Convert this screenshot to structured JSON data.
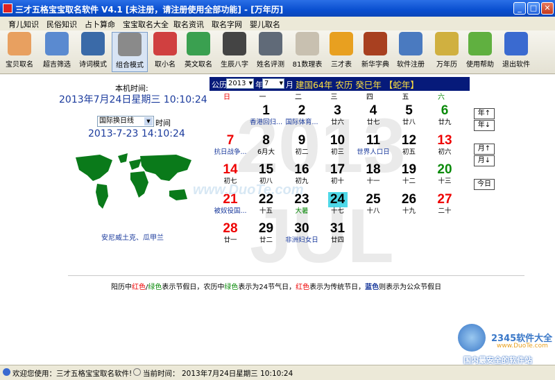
{
  "window": {
    "title": "三才五格宝宝取名软件 V4.1 [未注册，请注册使用全部功能] - [万年历]"
  },
  "menu": [
    "育儿知识",
    "民俗知识",
    "占卜算命",
    "宝宝取名大全",
    "取名资讯",
    "取名字网",
    "婴儿取名"
  ],
  "toolbar": [
    {
      "label": "宝贝取名",
      "icon": "baby-icon",
      "color": "#e8a060"
    },
    {
      "label": "超吉筛选",
      "icon": "magnifier-icon",
      "color": "#5a8ad0"
    },
    {
      "label": "诗词模式",
      "icon": "book-icon",
      "color": "#3a6aa8"
    },
    {
      "label": "组合模式",
      "icon": "gear-icon",
      "color": "#8a8a8a"
    },
    {
      "label": "取小名",
      "icon": "child-icon",
      "color": "#d04040"
    },
    {
      "label": "英文取名",
      "icon": "globe-icon",
      "color": "#3aa050"
    },
    {
      "label": "生辰八字",
      "icon": "yinyang-icon",
      "color": "#444444"
    },
    {
      "label": "姓名评测",
      "icon": "calculator-icon",
      "color": "#606a78"
    },
    {
      "label": "81数理表",
      "icon": "table-icon",
      "color": "#c8c0b0"
    },
    {
      "label": "三才表",
      "icon": "shell-icon",
      "color": "#e8a020"
    },
    {
      "label": "新华字典",
      "icon": "dictionary-icon",
      "color": "#a84020"
    },
    {
      "label": "软件注册",
      "icon": "tools-icon",
      "color": "#4a7ac0"
    },
    {
      "label": "万年历",
      "icon": "calendar-icon",
      "color": "#d0b040"
    },
    {
      "label": "使用帮助",
      "icon": "help-icon",
      "color": "#60b040"
    },
    {
      "label": "退出软件",
      "icon": "exit-icon",
      "color": "#3a6ad0"
    }
  ],
  "clock": {
    "local_label": "本机时间:",
    "local_time": "2013年7月24日星期三  10:10:24",
    "zone_select": "国际换日线",
    "zone_suffix": "时间",
    "zone_time": "2013-7-23 14:10:24",
    "location": "安尼威土克、瓜甲兰"
  },
  "calendar": {
    "gongli_label": "公历",
    "year": "2013",
    "year_unit": "年",
    "month": "7",
    "month_unit": "月",
    "lunar_info": "建国64年  农历 癸巳年 【蛇年】",
    "weekdays": [
      "日",
      "一",
      "二",
      "三",
      "四",
      "五",
      "六"
    ],
    "watermark_year": "2013",
    "watermark_month": "JUL",
    "selected_day": "24",
    "days": [
      {
        "n": "1",
        "l": "香港回归...",
        "col": 1,
        "row": 0,
        "nc": "#000",
        "lc": "#1a3a9c"
      },
      {
        "n": "2",
        "l": "国际体育...",
        "col": 2,
        "row": 0,
        "nc": "#000",
        "lc": "#1a3a9c"
      },
      {
        "n": "3",
        "l": "廿六",
        "col": 3,
        "row": 0,
        "nc": "#000",
        "lc": "#000"
      },
      {
        "n": "4",
        "l": "廿七",
        "col": 4,
        "row": 0,
        "nc": "#000",
        "lc": "#000"
      },
      {
        "n": "5",
        "l": "廿八",
        "col": 5,
        "row": 0,
        "nc": "#000",
        "lc": "#000"
      },
      {
        "n": "6",
        "l": "廿九",
        "col": 6,
        "row": 0,
        "nc": "#0a8a0a",
        "lc": "#000"
      },
      {
        "n": "7",
        "l": "抗日战争...",
        "col": 0,
        "row": 1,
        "nc": "#e00",
        "lc": "#1a3a9c"
      },
      {
        "n": "8",
        "l": "6月大",
        "col": 1,
        "row": 1,
        "nc": "#000",
        "lc": "#000"
      },
      {
        "n": "9",
        "l": "初二",
        "col": 2,
        "row": 1,
        "nc": "#000",
        "lc": "#000"
      },
      {
        "n": "10",
        "l": "初三",
        "col": 3,
        "row": 1,
        "nc": "#000",
        "lc": "#000"
      },
      {
        "n": "11",
        "l": "世界人口日",
        "col": 4,
        "row": 1,
        "nc": "#000",
        "lc": "#1a3a9c"
      },
      {
        "n": "12",
        "l": "初五",
        "col": 5,
        "row": 1,
        "nc": "#000",
        "lc": "#000"
      },
      {
        "n": "13",
        "l": "初六",
        "col": 6,
        "row": 1,
        "nc": "#e00",
        "lc": "#000"
      },
      {
        "n": "14",
        "l": "初七",
        "col": 0,
        "row": 2,
        "nc": "#e00",
        "lc": "#000"
      },
      {
        "n": "15",
        "l": "初八",
        "col": 1,
        "row": 2,
        "nc": "#000",
        "lc": "#000"
      },
      {
        "n": "16",
        "l": "初九",
        "col": 2,
        "row": 2,
        "nc": "#000",
        "lc": "#000"
      },
      {
        "n": "17",
        "l": "初十",
        "col": 3,
        "row": 2,
        "nc": "#000",
        "lc": "#000"
      },
      {
        "n": "18",
        "l": "十一",
        "col": 4,
        "row": 2,
        "nc": "#000",
        "lc": "#000"
      },
      {
        "n": "19",
        "l": "十二",
        "col": 5,
        "row": 2,
        "nc": "#000",
        "lc": "#000"
      },
      {
        "n": "20",
        "l": "十三",
        "col": 6,
        "row": 2,
        "nc": "#0a8a0a",
        "lc": "#000"
      },
      {
        "n": "21",
        "l": "被奴役国...",
        "col": 0,
        "row": 3,
        "nc": "#e00",
        "lc": "#1a3a9c"
      },
      {
        "n": "22",
        "l": "十五",
        "col": 1,
        "row": 3,
        "nc": "#000",
        "lc": "#000"
      },
      {
        "n": "23",
        "l": "大暑",
        "col": 2,
        "row": 3,
        "nc": "#000",
        "lc": "#0a8a0a"
      },
      {
        "n": "24",
        "l": "十七",
        "col": 3,
        "row": 3,
        "nc": "#000",
        "lc": "#000"
      },
      {
        "n": "25",
        "l": "十八",
        "col": 4,
        "row": 3,
        "nc": "#000",
        "lc": "#000"
      },
      {
        "n": "26",
        "l": "十九",
        "col": 5,
        "row": 3,
        "nc": "#000",
        "lc": "#000"
      },
      {
        "n": "27",
        "l": "二十",
        "col": 6,
        "row": 3,
        "nc": "#e00",
        "lc": "#000"
      },
      {
        "n": "28",
        "l": "廿一",
        "col": 0,
        "row": 4,
        "nc": "#e00",
        "lc": "#000"
      },
      {
        "n": "29",
        "l": "廿二",
        "col": 1,
        "row": 4,
        "nc": "#000",
        "lc": "#000"
      },
      {
        "n": "30",
        "l": "非洲妇女日",
        "col": 2,
        "row": 4,
        "nc": "#000",
        "lc": "#1a3a9c"
      },
      {
        "n": "31",
        "l": "廿四",
        "col": 3,
        "row": 4,
        "nc": "#000",
        "lc": "#000"
      }
    ],
    "nav": {
      "year_up": "年↑",
      "year_down": "年↓",
      "month_up": "月↑",
      "month_down": "月↓",
      "today": "今日"
    }
  },
  "legend": {
    "p1": "阳历中",
    "red1": "红色",
    "slash": "/",
    "green1": "绿色",
    "p2": "表示节假日，农历中",
    "green2": "绿色",
    "p3": "表示为24节气日，",
    "red2": "红色",
    "p4": "表示为传统节日，",
    "blue": "蓝色",
    "p5": "则表示为公众节假日"
  },
  "watermarks": {
    "site": "www.DuoTe.com",
    "brand": "2345软件大全",
    "brand_url": "www.DuoTe.com",
    "brand_tag": "国内最安全的软件站"
  },
  "status": {
    "welcome": "欢迎您使用：三才五格宝宝取名软件!",
    "current_label": "当前时间：",
    "current_time": "2013年7月24日星期三   10:10:24"
  },
  "colors": {
    "title": "#0a4fd0",
    "cal_header": "#061a7a",
    "selected": "#4fd8e8",
    "map": "#0a7a1a"
  }
}
